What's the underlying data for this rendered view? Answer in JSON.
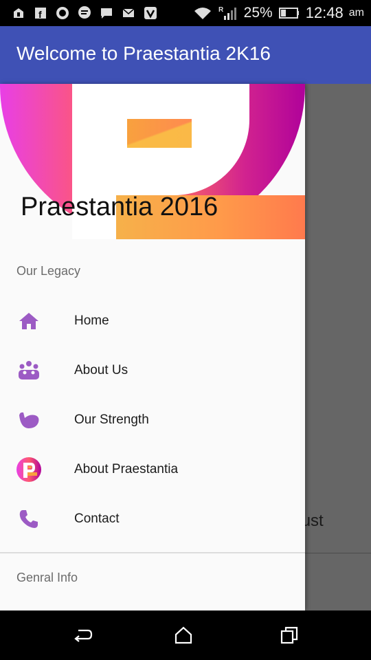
{
  "status_bar": {
    "battery_percent": "25%",
    "time": "12:48",
    "ampm": "am",
    "network_label": "R",
    "icons": [
      "sim-icon",
      "facebook-icon",
      "circle-app-icon",
      "chat-icon",
      "message-icon",
      "email-icon",
      "savn-icon",
      "wifi-icon",
      "signal-icon",
      "battery-icon"
    ]
  },
  "app_bar": {
    "title": "Welcome to Praestantia 2K16"
  },
  "drawer": {
    "header_title": "Praestantia 2016",
    "sections": [
      {
        "label": "Our Legacy",
        "items": [
          {
            "label": "Home",
            "icon": "home-icon"
          },
          {
            "label": "About Us",
            "icon": "group-icon"
          },
          {
            "label": "Our Strength",
            "icon": "bicep-icon"
          },
          {
            "label": "About Praestantia",
            "icon": "praestantia-logo-icon"
          },
          {
            "label": "Contact",
            "icon": "phone-icon"
          }
        ]
      },
      {
        "label": "Genral Info",
        "items": []
      }
    ]
  },
  "background_content": {
    "partial_text": "ugust"
  },
  "colors": {
    "primary": "#3f51b5",
    "icon_purple": "#9c5bc4",
    "scrim": "rgba(0,0,0,0.6)"
  }
}
